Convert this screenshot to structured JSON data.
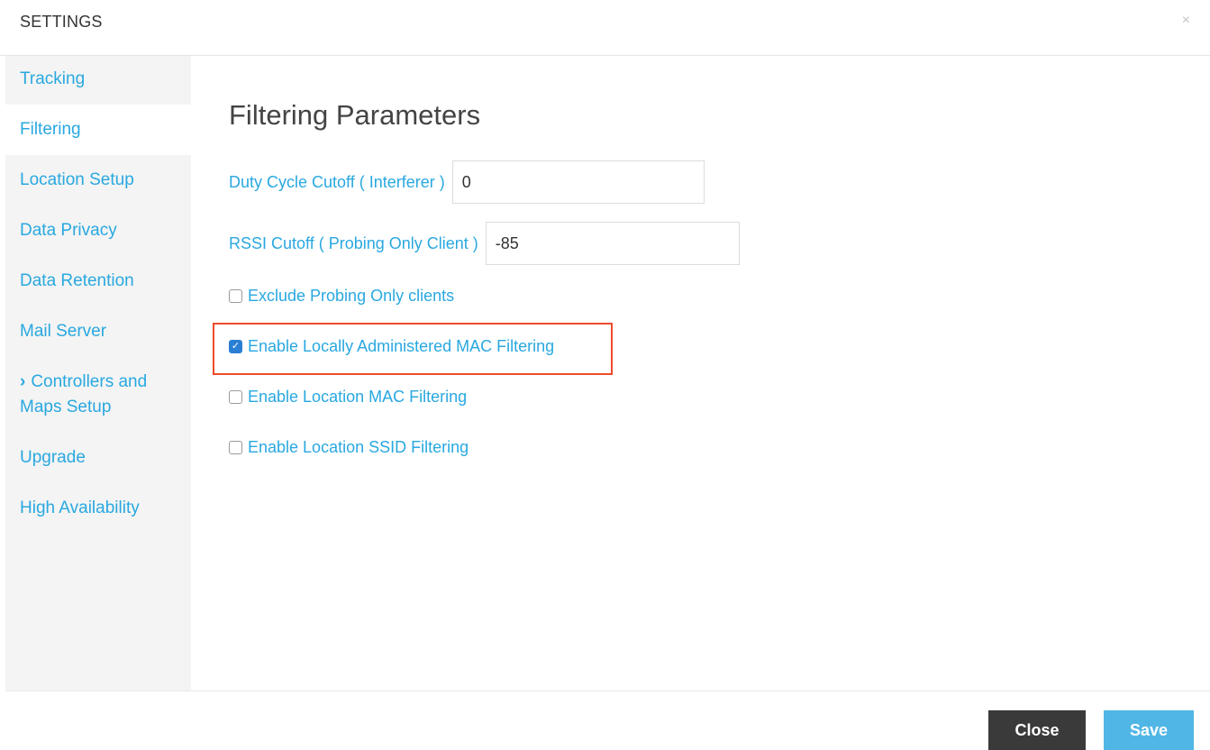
{
  "header": {
    "title": "SETTINGS",
    "close_glyph": "×"
  },
  "sidebar": {
    "items": [
      {
        "label": "Tracking"
      },
      {
        "label": "Filtering"
      },
      {
        "label": "Location Setup"
      },
      {
        "label": "Data Privacy"
      },
      {
        "label": "Data Retention"
      },
      {
        "label": "Mail Server"
      },
      {
        "label": "Controllers and Maps Setup",
        "chevron": "›"
      },
      {
        "label": "Upgrade"
      },
      {
        "label": "High Availability"
      }
    ],
    "active_index": 1
  },
  "main": {
    "heading": "Filtering Parameters",
    "duty_cycle": {
      "label": "Duty Cycle Cutoff ( Interferer )",
      "value": "0"
    },
    "rssi": {
      "label": "RSSI Cutoff ( Probing Only Client )",
      "value": "-85"
    },
    "checkboxes": [
      {
        "label": "Exclude Probing Only clients",
        "checked": false
      },
      {
        "label": "Enable Locally Administered MAC Filtering",
        "checked": true
      },
      {
        "label": "Enable Location MAC Filtering",
        "checked": false
      },
      {
        "label": "Enable Location SSID Filtering",
        "checked": false
      }
    ]
  },
  "footer": {
    "close_label": "Close",
    "save_label": "Save"
  },
  "colors": {
    "link": "#29a8e0",
    "highlight": "#ee4b2b",
    "save_button": "#50b6e6",
    "close_button": "#3a3a3a"
  }
}
